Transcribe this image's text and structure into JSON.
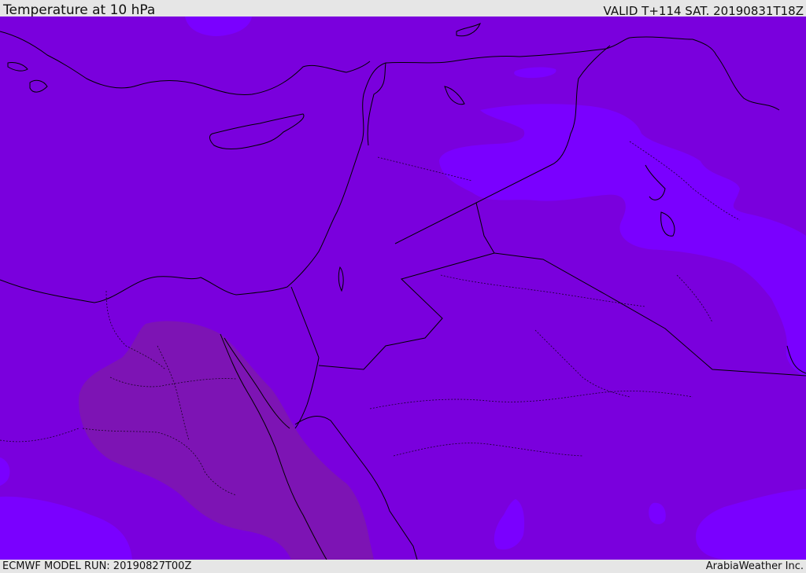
{
  "header": {
    "title": "Temperature at 10 hPa",
    "valid": "VALID T+114 SAT. 20190831T18Z"
  },
  "footer": {
    "model_run": "ECMWF MODEL RUN: 20190827T00Z",
    "credit": "ArabiaWeather Inc."
  },
  "colors": {
    "base_fill": "#7a00dd",
    "warm_fill": "#7d14b4",
    "cool_fill": "#7a00ff",
    "coastline": "#000000",
    "panel": "#e6e6e6"
  }
}
